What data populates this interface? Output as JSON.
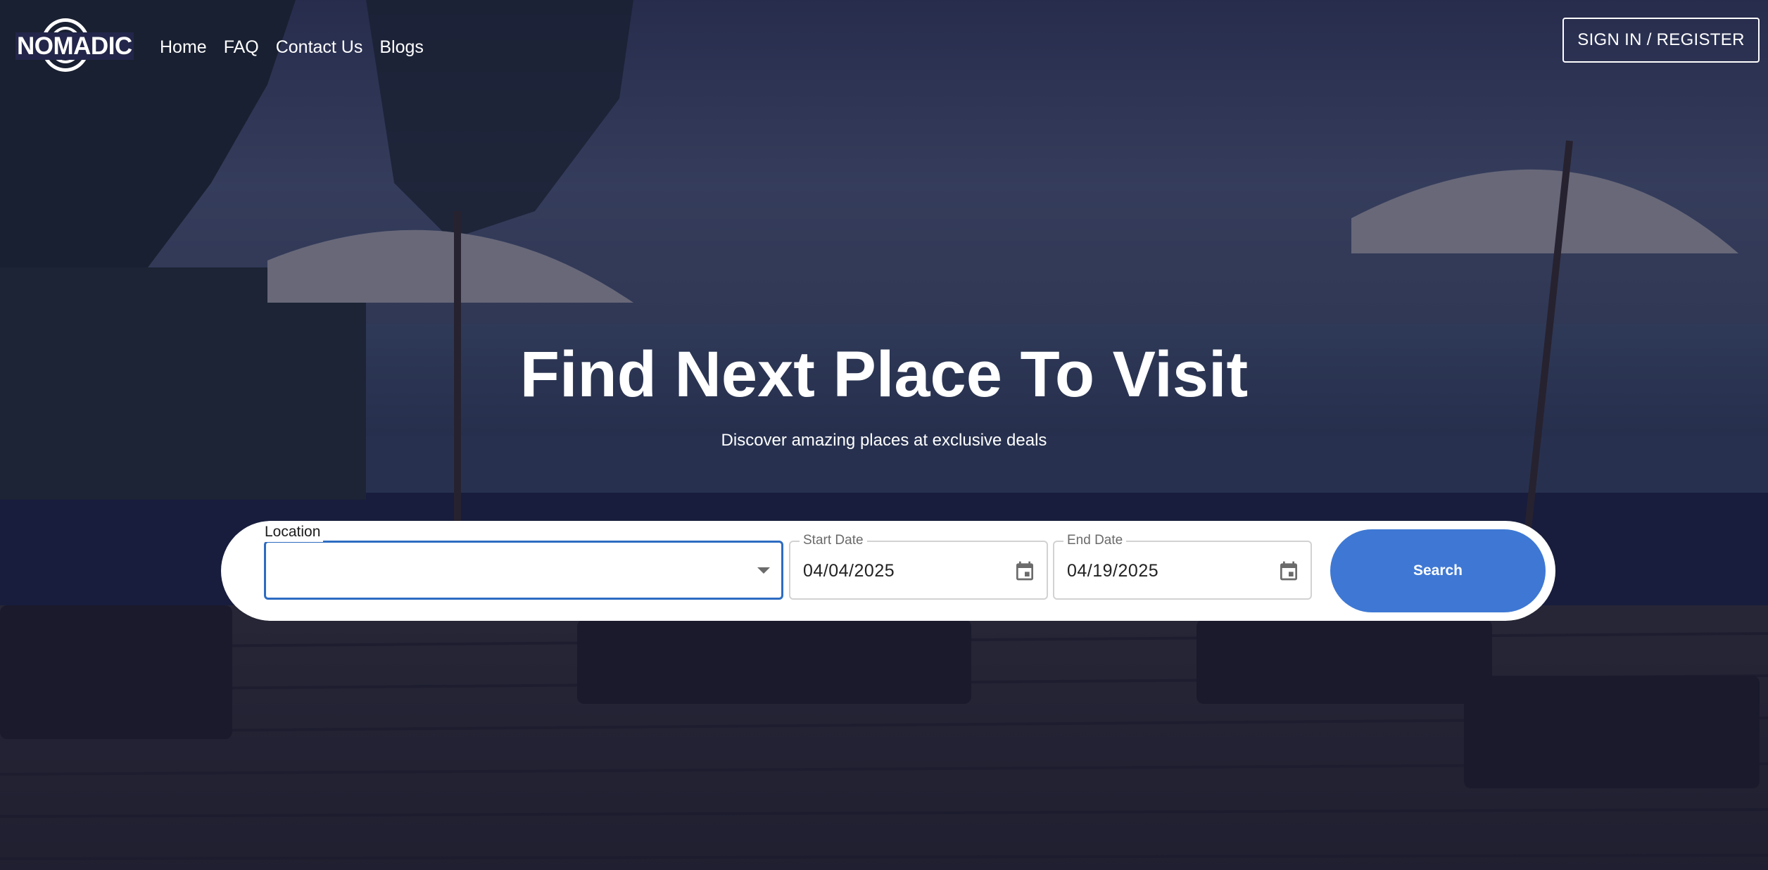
{
  "brand": {
    "logo_text": "NOMADIC"
  },
  "nav": {
    "items": [
      {
        "label": "Home"
      },
      {
        "label": "FAQ"
      },
      {
        "label": "Contact Us"
      },
      {
        "label": "Blogs"
      }
    ],
    "signin_label": "SIGN IN / REGISTER"
  },
  "hero": {
    "title": "Find Next Place To Visit",
    "subtitle": "Discover amazing places at exclusive deals"
  },
  "search": {
    "location_label": "Location",
    "location_value": "",
    "start_date_label": "Start Date",
    "start_date_value": "04/04/2025",
    "end_date_label": "End Date",
    "end_date_value": "04/19/2025",
    "search_button_label": "Search"
  },
  "colors": {
    "accent": "#3e78d4",
    "focus_border": "#2d6cc2",
    "overlay": "#181c3e"
  },
  "icons": {
    "dropdown": "chevron-down-icon",
    "calendar": "calendar-icon"
  }
}
